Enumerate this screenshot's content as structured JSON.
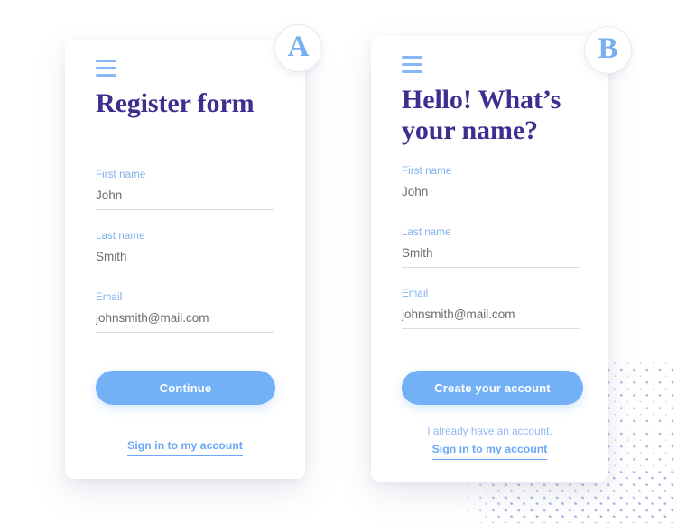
{
  "background": {
    "color": "#ffffff",
    "dot_pattern_color": "#a8b0e0"
  },
  "theme": {
    "accent_blue": "#74b0f6",
    "label_blue": "#7fb0ee",
    "heading_indigo": "#3f2e90",
    "value_gray": "#6c6c70",
    "underline_gray": "#dadde3"
  },
  "cards": [
    {
      "id": "register-form",
      "avatar_letter": "A",
      "menu_icon": "hamburger-icon",
      "heading": "Register form",
      "fields": [
        {
          "label": "First name",
          "value": "John",
          "placeholder": "First name"
        },
        {
          "label": "Last name",
          "value": "Smith",
          "placeholder": "Last name"
        },
        {
          "label": "Email",
          "value": "johnsmith@mail.com",
          "placeholder": "Email"
        }
      ],
      "primary_button": "Continue",
      "note": "",
      "signin_link": "Sign in to my account"
    },
    {
      "id": "hello-name-form",
      "avatar_letter": "B",
      "menu_icon": "hamburger-icon",
      "heading": "Hello! What’s your name?",
      "fields": [
        {
          "label": "First name",
          "value": "John",
          "placeholder": "First name"
        },
        {
          "label": "Last name",
          "value": "Smith",
          "placeholder": "Last name"
        },
        {
          "label": "Email",
          "value": "johnsmith@mail.com",
          "placeholder": "Email"
        }
      ],
      "primary_button": "Create your account",
      "note": "I already have an account.",
      "signin_link": "Sign in to my account"
    }
  ]
}
